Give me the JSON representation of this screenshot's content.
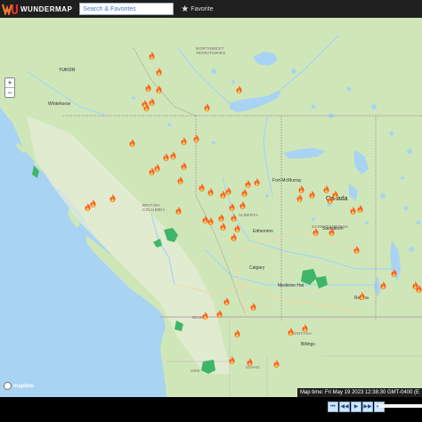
{
  "header": {
    "brand": "WUNDERMAP",
    "search_placeholder": "Search & Favorites",
    "favorite_label": "Favorite"
  },
  "map": {
    "zoom_in": "+",
    "zoom_out": "−",
    "attribution": "mapbox",
    "map_time": "Map time: Fri May 19 2023 12:38:30 GMT-0400 (E",
    "labels": [
      {
        "id": "yukon",
        "text": "YUKON"
      },
      {
        "id": "nwt",
        "text": "NORTHWEST TERRITORIES"
      },
      {
        "id": "whitehorse",
        "text": "Whitehorse"
      },
      {
        "id": "bc",
        "text": "BRITISH COLUMBIA"
      },
      {
        "id": "alberta",
        "text": "ALBERTA"
      },
      {
        "id": "saskatchewan",
        "text": "SASKATCHEWAN"
      },
      {
        "id": "canada",
        "text": "Canada"
      },
      {
        "id": "edmonton",
        "text": "Edmonton"
      },
      {
        "id": "calgary",
        "text": "Calgary"
      },
      {
        "id": "saskatoon",
        "text": "Saskatoon"
      },
      {
        "id": "regina",
        "text": "Regina"
      },
      {
        "id": "wash",
        "text": "WASH"
      },
      {
        "id": "montana",
        "text": "MONTANA"
      },
      {
        "id": "idaho",
        "text": "IDAHO"
      },
      {
        "id": "ore",
        "text": "ORE"
      },
      {
        "id": "fort_mcmurray",
        "text": "Fort McMurray"
      },
      {
        "id": "billings",
        "text": "Billings"
      },
      {
        "id": "medicine_hat",
        "text": "Medicine Hat"
      }
    ],
    "fire_icon": "fire-icon",
    "fire_count": 64
  },
  "controls": {
    "first": "⏮",
    "back": "◀◀",
    "play": "▶",
    "forward": "▶▶",
    "last": "⏭"
  },
  "colors": {
    "water": "#a9d3f2",
    "land": "#cfe7b8",
    "fire": "#ff5a1f",
    "brand": "#f0772f"
  }
}
